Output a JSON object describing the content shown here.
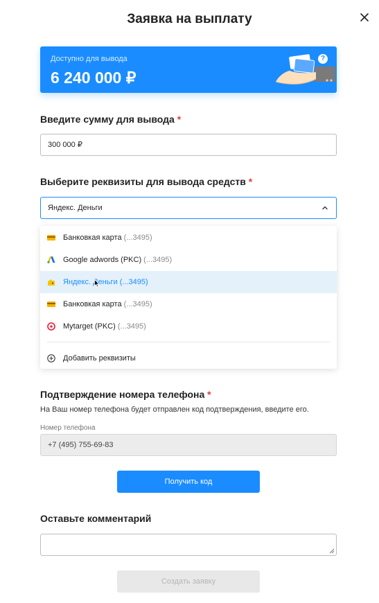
{
  "modal": {
    "title": "Заявка на выплату",
    "close_icon": "close-icon"
  },
  "balance": {
    "caption": "Доступно для вывода",
    "amount": "6 240 000 ₽",
    "help_icon": "question-icon",
    "help_glyph": "?",
    "colors": {
      "background": "#1a8cff"
    }
  },
  "amount_field": {
    "label": "Введите сумму для вывода",
    "required_mark": "*",
    "value": "300 000 ₽"
  },
  "requisites": {
    "label": "Выберите реквизиты для вывода средств",
    "required_mark": "*",
    "selected": "Яндекс. Деньги",
    "chevron_icon": "chevron-up-icon",
    "options": [
      {
        "icon": "bank-card-icon",
        "name": "Банковкая карта",
        "suffix": "(...3495)"
      },
      {
        "icon": "google-adwords-icon",
        "name": "Google adwords (PKC)",
        "suffix": "(...3495)"
      },
      {
        "icon": "yandex-money-icon",
        "name": "Яндекс. Деньги",
        "suffix": "(...3495)",
        "highlighted": true
      },
      {
        "icon": "bank-card-icon",
        "name": "Банковкая карта",
        "suffix": "(...3495)"
      },
      {
        "icon": "mytarget-icon",
        "name": "Mytarget (PKC)",
        "suffix": "(...3495)"
      }
    ],
    "add_label": "Добавить реквизиты",
    "add_icon": "plus-circle-icon"
  },
  "phone": {
    "label": "Подтверждение номера телефона",
    "required_mark": "*",
    "hint": "На Ваш номер телефона будет отправлен код подтверждения, введите его.",
    "field_label": "Номер телефона",
    "value": "+7 (495) 755-69-83",
    "get_code_label": "Получить код"
  },
  "comment": {
    "label": "Оставьте комментарий",
    "value": ""
  },
  "submit": {
    "label": "Создать заявку",
    "enabled": false
  },
  "colors": {
    "accent": "#1a8cff",
    "required": "#e53935",
    "highlight": "#e4f1fb"
  }
}
